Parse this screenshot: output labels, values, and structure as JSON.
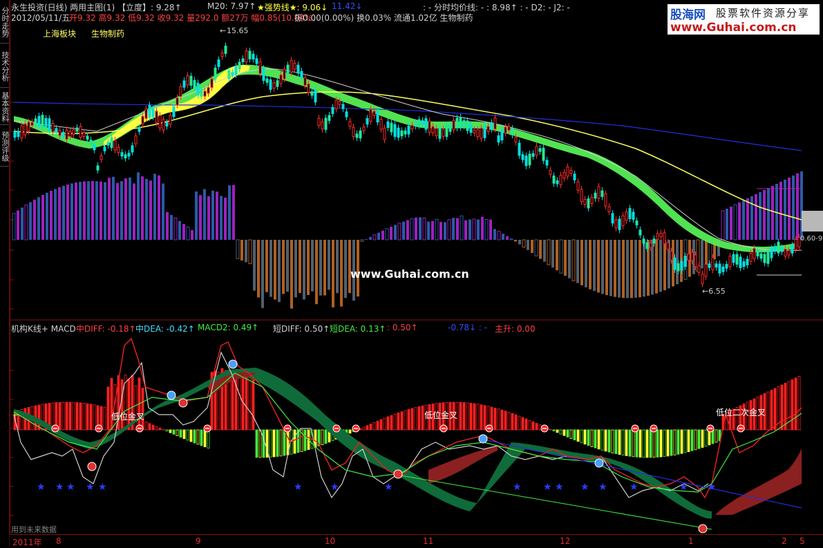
{
  "side_tabs": [
    {
      "label": "分时走势"
    },
    {
      "label": "技术分析"
    },
    {
      "label": "基本资料"
    },
    {
      "label": "预测评级"
    }
  ],
  "header": {
    "line1_left": "永生投资(日线) 两用主图(1) 【立度】: 9.28↑",
    "line1_m20": "M20: 7.97↑",
    "line1_strong": "★强势线★: 9.06↓",
    "line1_blue": "11.42↓",
    "line1_right": ": -  分时均价线: - : 8.98↑ : -  D2: -  J2: -",
    "line2_date": "2012/05/11/五",
    "line2_prices": "开9.32 高9.32 低9.32 收9.32 量292.0 额27万 幅0.85(10.04%)",
    "line2_rest": "振0.00(0.00%) 换0.03% 流通1.02亿 生物制药",
    "sector1": "上海板块",
    "sector2": "生物制药"
  },
  "logo": {
    "main": "股海网",
    "tag": "股票软件资源分享",
    "url": "www.Guhai.com.cn"
  },
  "watermark": "www.Guhai.com.cn",
  "price_labels": {
    "high": "15.65",
    "low": "←6.55",
    "right_axis": "0.60-9"
  },
  "macd_header": {
    "title": "机构K线+ MACD",
    "diff": "中DIFF: -0.18↑",
    "dea": "中DEA: -0.42↑",
    "macd2": "MACD2: 0.49↑",
    "short_diff": "短DIFF: 0.50↑",
    "short_dea": "短DEA: 0.13↑",
    "extra": ": 0.50↑",
    "blue": "-0.78↓ : -",
    "main_up": "主升: 0.00"
  },
  "annotations": {
    "cross1": "低位金叉",
    "cross2": "低位金叉",
    "cross3": "低位二次金叉",
    "future": "用到未来数据"
  },
  "axis": {
    "labels": [
      "2011年",
      "8",
      "9",
      "10",
      "11",
      "12",
      "1",
      "2",
      "5"
    ]
  },
  "colors": {
    "up": "#ff2a2a",
    "down": "#00e0e0",
    "ma_yellow": "#ffff40",
    "ribbon_green": "#55ee55",
    "blue_line": "#2030e0",
    "magenta": "#a020c0"
  }
}
